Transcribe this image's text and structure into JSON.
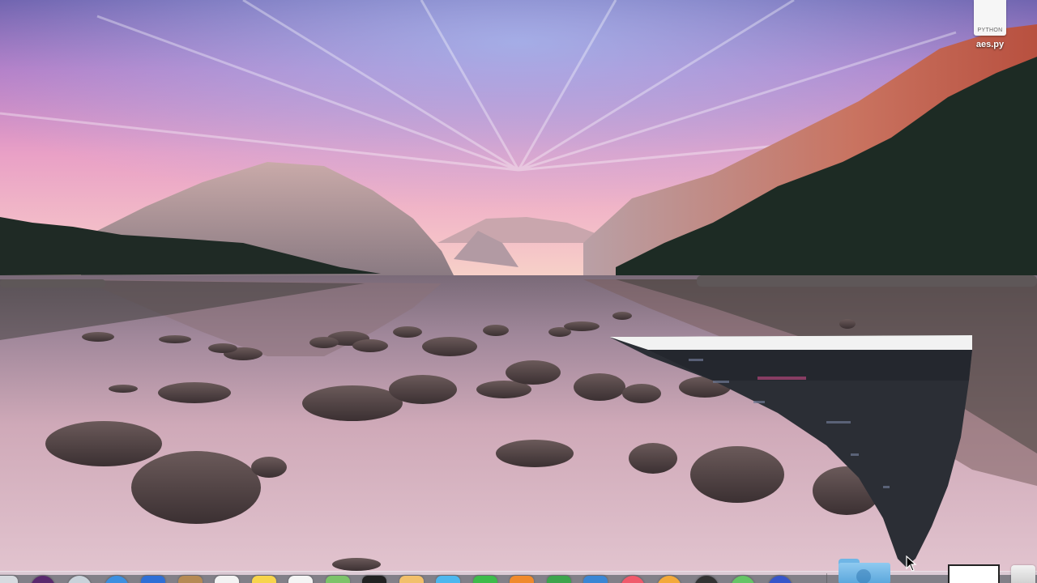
{
  "desktop": {
    "wallpaper": "mountain-lake-sunset",
    "files": [
      {
        "name": "aes.py",
        "kind": "PYTHON",
        "icon": "python-file-icon"
      }
    ]
  },
  "window": {
    "state": "minimizing",
    "title_bar_color": "#f2f2f2",
    "body_color": "#2b2e35"
  },
  "dock": {
    "apps": [
      {
        "name": "finder-icon",
        "color": "#d7dbe0"
      },
      {
        "name": "siri-icon",
        "color": "#5a2a6e"
      },
      {
        "name": "launchpad-icon",
        "color": "#c9d2da"
      },
      {
        "name": "safari-icon",
        "color": "#3c8fe0"
      },
      {
        "name": "mail-icon",
        "color": "#2f6fd6"
      },
      {
        "name": "contacts-icon",
        "color": "#b58a55"
      },
      {
        "name": "calendar-icon",
        "color": "#f3f3f3"
      },
      {
        "name": "notes-icon",
        "color": "#f7d44c"
      },
      {
        "name": "reminders-icon",
        "color": "#f5f5f5"
      },
      {
        "name": "maps-icon",
        "color": "#7cc36a"
      },
      {
        "name": "terminal-icon",
        "color": "#222222"
      },
      {
        "name": "photos-icon",
        "color": "#f2c06b"
      },
      {
        "name": "messages-icon",
        "color": "#4db7ee"
      },
      {
        "name": "facetime-icon",
        "color": "#3dbb4b"
      },
      {
        "name": "ibooks-icon",
        "color": "#f08a2c"
      },
      {
        "name": "numbers-icon",
        "color": "#3da44d"
      },
      {
        "name": "keynote-icon",
        "color": "#3a86d4"
      },
      {
        "name": "itunes-icon",
        "color": "#f05a6b"
      },
      {
        "name": "ibooks-store-icon",
        "color": "#f3a93a"
      },
      {
        "name": "activity-monitor-icon",
        "color": "#333333"
      },
      {
        "name": "app-store-icon",
        "color": "#65c466"
      },
      {
        "name": "system-preferences-icon",
        "color": "#3756c9"
      }
    ],
    "folder": {
      "name": "downloads-folder-icon",
      "color": "#6fb6e6"
    },
    "trash": {
      "name": "trash-icon"
    }
  },
  "cursor": {
    "type": "arrow"
  }
}
